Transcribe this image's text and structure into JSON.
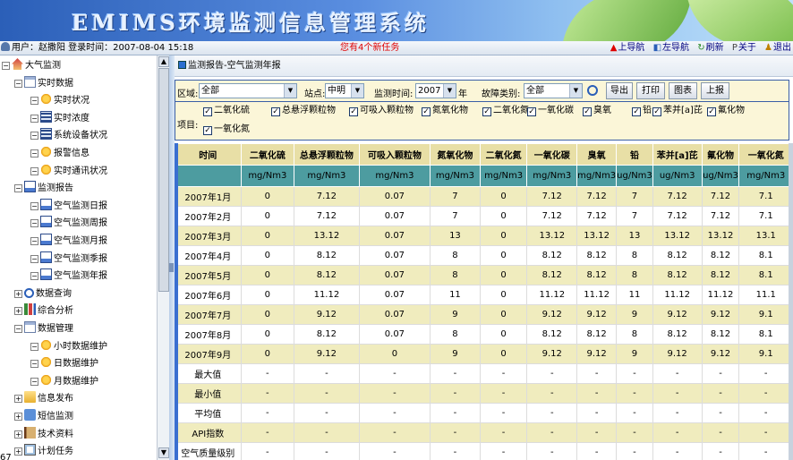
{
  "app": {
    "title": "EMIMS环境监测信息管理系统"
  },
  "status": {
    "user_label": "用户：赵撒阳  登录时间：2007-08-04 15:18",
    "tasks": "您有4个新任务",
    "nav": [
      "上导航",
      "左导航",
      "刷新",
      "关于",
      "退出"
    ]
  },
  "tree": [
    {
      "label": "大气监测",
      "level": 0,
      "icon": "home-icon",
      "sign": "−"
    },
    {
      "label": "实时数据",
      "level": 1,
      "icon": "document-icon",
      "sign": "−"
    },
    {
      "label": "实时状况",
      "level": 2,
      "icon": "gear-icon",
      "sign": "−"
    },
    {
      "label": "实时浓度",
      "level": 2,
      "icon": "grid-icon",
      "sign": "−"
    },
    {
      "label": "系统设备状况",
      "level": 2,
      "icon": "grid-icon",
      "sign": "−"
    },
    {
      "label": "报警信息",
      "level": 2,
      "icon": "gear-icon",
      "sign": "−"
    },
    {
      "label": "实时通讯状况",
      "level": 2,
      "icon": "gear-icon",
      "sign": "−"
    },
    {
      "label": "监测报告",
      "level": 1,
      "icon": "report-icon",
      "sign": "−"
    },
    {
      "label": "空气监测日报",
      "level": 2,
      "icon": "report-icon",
      "sign": "−"
    },
    {
      "label": "空气监测周报",
      "level": 2,
      "icon": "report-icon",
      "sign": "−"
    },
    {
      "label": "空气监测月报",
      "level": 2,
      "icon": "report-icon",
      "sign": "−"
    },
    {
      "label": "空气监测季报",
      "level": 2,
      "icon": "report-icon",
      "sign": "−"
    },
    {
      "label": "空气监测年报",
      "level": 2,
      "icon": "report-icon",
      "sign": "−"
    },
    {
      "label": "数据查询",
      "level": 1,
      "icon": "magnifier-icon",
      "sign": "+"
    },
    {
      "label": "综合分析",
      "level": 1,
      "icon": "chart-icon",
      "sign": "+"
    },
    {
      "label": "数据管理",
      "level": 1,
      "icon": "document-icon",
      "sign": "−"
    },
    {
      "label": "小时数据维护",
      "level": 2,
      "icon": "gear-icon",
      "sign": "−"
    },
    {
      "label": "日数据维护",
      "level": 2,
      "icon": "gear-icon",
      "sign": "−"
    },
    {
      "label": "月数据维护",
      "level": 2,
      "icon": "gear-icon",
      "sign": "−"
    },
    {
      "label": "信息发布",
      "level": 1,
      "icon": "folder-icon",
      "sign": "+"
    },
    {
      "label": "短信监测",
      "level": 1,
      "icon": "message-icon",
      "sign": "+"
    },
    {
      "label": "技术资料",
      "level": 1,
      "icon": "book-icon",
      "sign": "+"
    },
    {
      "label": "计划任务",
      "level": 1,
      "icon": "plan-icon",
      "sign": "+"
    }
  ],
  "left_bottom_text": "67",
  "breadcrumb": "监测报告-空气监测年报",
  "filter": {
    "region_label": "区域:",
    "region_value": "全部",
    "station_label": "站点:",
    "station_value": "中明",
    "time_label": "监测时间:",
    "year_value": "2007",
    "year_suffix": "年",
    "fault_label": "故障类别:",
    "fault_value": "全部",
    "buttons": [
      "导出",
      "打印",
      "图表",
      "上报"
    ]
  },
  "items": {
    "label": "项目:",
    "checks": [
      "二氧化硫",
      "总悬浮颗粒物",
      "可吸入颗粒物",
      "氮氧化物",
      "二氧化氮",
      "一氧化碳",
      "臭氧",
      "铅",
      "苯并[a]芘",
      "氟化物",
      "一氧化氮"
    ]
  },
  "table": {
    "headers": [
      "时间",
      "二氧化硫",
      "总悬浮颗粒物",
      "可吸入颗粒物",
      "氮氧化物",
      "二氧化氮",
      "一氧化碳",
      "臭氧",
      "铅",
      "苯并[a]芘",
      "氟化物",
      "一氧化氮"
    ],
    "units": [
      "",
      "mg/Nm3",
      "mg/Nm3",
      "mg/Nm3",
      "mg/Nm3",
      "mg/Nm3",
      "mg/Nm3",
      "mg/Nm3",
      "ug/Nm3",
      "ug/Nm3",
      "ug/Nm3",
      "mg/Nm3"
    ],
    "rows": [
      [
        "2007年1月",
        "0",
        "7.12",
        "0.07",
        "7",
        "0",
        "7.12",
        "7.12",
        "7",
        "7.12",
        "7.12",
        "7.1"
      ],
      [
        "2007年2月",
        "0",
        "7.12",
        "0.07",
        "7",
        "0",
        "7.12",
        "7.12",
        "7",
        "7.12",
        "7.12",
        "7.1"
      ],
      [
        "2007年3月",
        "0",
        "13.12",
        "0.07",
        "13",
        "0",
        "13.12",
        "13.12",
        "13",
        "13.12",
        "13.12",
        "13.1"
      ],
      [
        "2007年4月",
        "0",
        "8.12",
        "0.07",
        "8",
        "0",
        "8.12",
        "8.12",
        "8",
        "8.12",
        "8.12",
        "8.1"
      ],
      [
        "2007年5月",
        "0",
        "8.12",
        "0.07",
        "8",
        "0",
        "8.12",
        "8.12",
        "8",
        "8.12",
        "8.12",
        "8.1"
      ],
      [
        "2007年6月",
        "0",
        "11.12",
        "0.07",
        "11",
        "0",
        "11.12",
        "11.12",
        "11",
        "11.12",
        "11.12",
        "11.1"
      ],
      [
        "2007年7月",
        "0",
        "9.12",
        "0.07",
        "9",
        "0",
        "9.12",
        "9.12",
        "9",
        "9.12",
        "9.12",
        "9.1"
      ],
      [
        "2007年8月",
        "0",
        "8.12",
        "0.07",
        "8",
        "0",
        "8.12",
        "8.12",
        "8",
        "8.12",
        "8.12",
        "8.1"
      ],
      [
        "2007年9月",
        "0",
        "9.12",
        "0",
        "9",
        "0",
        "9.12",
        "9.12",
        "9",
        "9.12",
        "9.12",
        "9.1"
      ],
      [
        "最大值",
        "-",
        "-",
        "-",
        "-",
        "-",
        "-",
        "-",
        "-",
        "-",
        "-",
        "-"
      ],
      [
        "最小值",
        "-",
        "-",
        "-",
        "-",
        "-",
        "-",
        "-",
        "-",
        "-",
        "-",
        "-"
      ],
      [
        "平均值",
        "-",
        "-",
        "-",
        "-",
        "-",
        "-",
        "-",
        "-",
        "-",
        "-",
        "-"
      ],
      [
        "API指数",
        "-",
        "-",
        "-",
        "-",
        "-",
        "-",
        "-",
        "-",
        "-",
        "-",
        "-"
      ],
      [
        "空气质量级别",
        "-",
        "-",
        "-",
        "-",
        "-",
        "-",
        "-",
        "-",
        "-",
        "-",
        "-"
      ]
    ]
  },
  "colors": {
    "header_bg": "#e8dfa6",
    "unit_bg": "#4d9ca0",
    "row_alt": "#f0ecbe",
    "task_red": "#e00000"
  }
}
